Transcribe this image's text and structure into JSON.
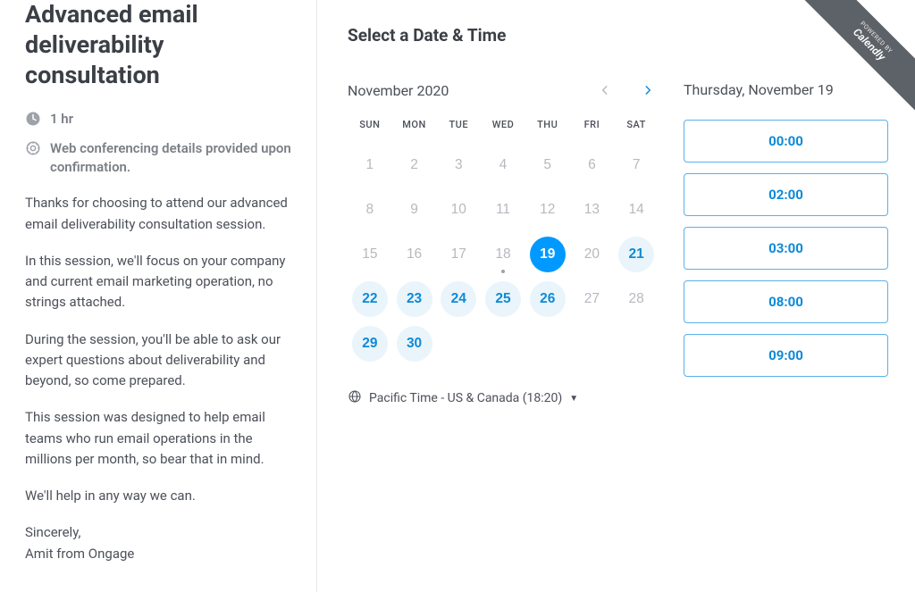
{
  "left": {
    "title": "Advanced email deliverability consultation",
    "duration": "1 hr",
    "conference_note": "Web conferencing details provided upon confirmation.",
    "paras": [
      "Thanks for choosing to attend our advanced email deliverability consultation session.",
      "In this session, we'll focus on your company and current email marketing operation, no strings attached.",
      "During the session, you'll be able to ask our expert questions about deliverability and beyond, so come prepared.",
      "This session was designed to help email teams who run email operations in the millions per month, so bear that in mind.",
      "We'll help in any way we can.",
      "Sincerely,\nAmit from Ongage"
    ]
  },
  "right": {
    "heading": "Select a Date & Time",
    "month_label": "November 2020",
    "dow": [
      "SUN",
      "MON",
      "TUE",
      "WED",
      "THU",
      "FRI",
      "SAT"
    ],
    "days": [
      {
        "n": "1",
        "state": "disabled"
      },
      {
        "n": "2",
        "state": "disabled"
      },
      {
        "n": "3",
        "state": "disabled"
      },
      {
        "n": "4",
        "state": "disabled"
      },
      {
        "n": "5",
        "state": "disabled"
      },
      {
        "n": "6",
        "state": "disabled"
      },
      {
        "n": "7",
        "state": "disabled"
      },
      {
        "n": "8",
        "state": "disabled"
      },
      {
        "n": "9",
        "state": "disabled"
      },
      {
        "n": "10",
        "state": "disabled"
      },
      {
        "n": "11",
        "state": "disabled"
      },
      {
        "n": "12",
        "state": "disabled"
      },
      {
        "n": "13",
        "state": "disabled"
      },
      {
        "n": "14",
        "state": "disabled"
      },
      {
        "n": "15",
        "state": "disabled"
      },
      {
        "n": "16",
        "state": "disabled"
      },
      {
        "n": "17",
        "state": "disabled"
      },
      {
        "n": "18",
        "state": "disabled",
        "today": true
      },
      {
        "n": "19",
        "state": "selected"
      },
      {
        "n": "20",
        "state": "disabled"
      },
      {
        "n": "21",
        "state": "available"
      },
      {
        "n": "22",
        "state": "available"
      },
      {
        "n": "23",
        "state": "available"
      },
      {
        "n": "24",
        "state": "available"
      },
      {
        "n": "25",
        "state": "available"
      },
      {
        "n": "26",
        "state": "available"
      },
      {
        "n": "27",
        "state": "disabled"
      },
      {
        "n": "28",
        "state": "disabled"
      },
      {
        "n": "29",
        "state": "available"
      },
      {
        "n": "30",
        "state": "available"
      }
    ],
    "timezone": "Pacific Time - US & Canada (18:20)",
    "selected_date_label": "Thursday, November 19",
    "time_slots": [
      "00:00",
      "02:00",
      "03:00",
      "08:00",
      "09:00"
    ]
  },
  "ribbon": {
    "small": "POWERED BY",
    "brand": "Calendly"
  }
}
